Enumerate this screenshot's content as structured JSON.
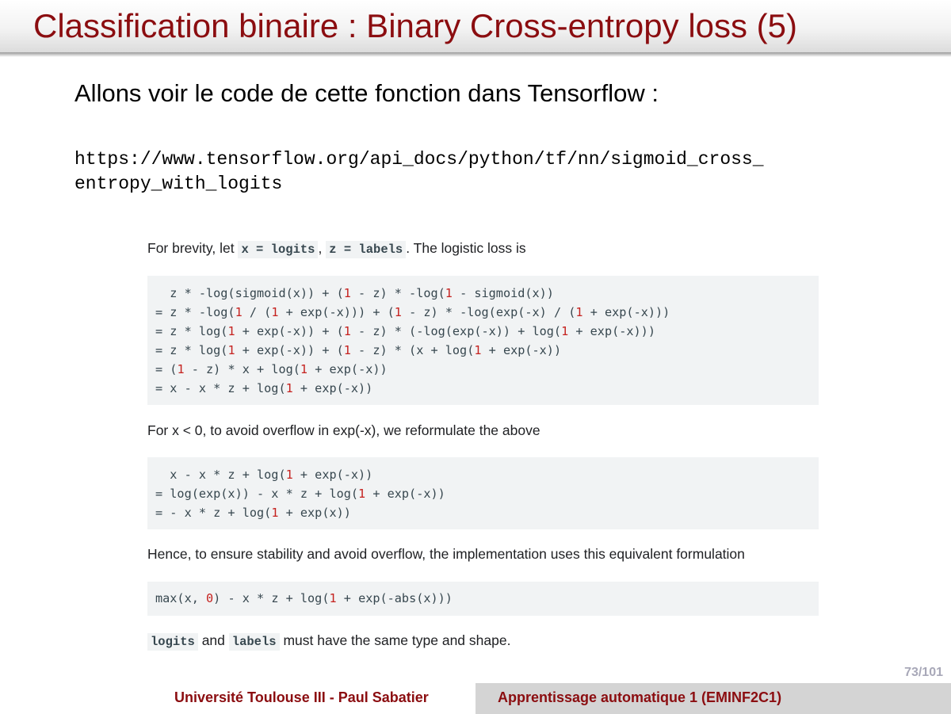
{
  "slide": {
    "title": "Classification binaire : Binary Cross-entropy loss (5)",
    "intro": "Allons voir le code de cette fonction dans Tensorflow :",
    "url_line1": "https://www.tensorflow.org/api_docs/python/tf/nn/sigmoid_cross_",
    "url_line2": "entropy_with_logits",
    "page_number": "73/101"
  },
  "doc": {
    "p1_prefix": "For brevity, let",
    "p1_code1": "x = logits",
    "p1_sep": ",",
    "p1_code2": "z = labels",
    "p1_suffix": ". The logistic loss is",
    "code1": [
      [
        {
          "t": "  z * -log(sigmoid(x)) + ("
        },
        {
          "t": "1",
          "n": true
        },
        {
          "t": " - z) * -log("
        },
        {
          "t": "1",
          "n": true
        },
        {
          "t": " - sigmoid(x))"
        }
      ],
      [
        {
          "t": "= z * -log("
        },
        {
          "t": "1",
          "n": true
        },
        {
          "t": " / ("
        },
        {
          "t": "1",
          "n": true
        },
        {
          "t": " + exp(-x))) + ("
        },
        {
          "t": "1",
          "n": true
        },
        {
          "t": " - z) * -log(exp(-x) / ("
        },
        {
          "t": "1",
          "n": true
        },
        {
          "t": " + exp(-x)))"
        }
      ],
      [
        {
          "t": "= z * log("
        },
        {
          "t": "1",
          "n": true
        },
        {
          "t": " + exp(-x)) + ("
        },
        {
          "t": "1",
          "n": true
        },
        {
          "t": " - z) * (-log(exp(-x)) + log("
        },
        {
          "t": "1",
          "n": true
        },
        {
          "t": " + exp(-x)))"
        }
      ],
      [
        {
          "t": "= z * log("
        },
        {
          "t": "1",
          "n": true
        },
        {
          "t": " + exp(-x)) + ("
        },
        {
          "t": "1",
          "n": true
        },
        {
          "t": " - z) * (x + log("
        },
        {
          "t": "1",
          "n": true
        },
        {
          "t": " + exp(-x))"
        }
      ],
      [
        {
          "t": "= ("
        },
        {
          "t": "1",
          "n": true
        },
        {
          "t": " - z) * x + log("
        },
        {
          "t": "1",
          "n": true
        },
        {
          "t": " + exp(-x))"
        }
      ],
      [
        {
          "t": "= x - x * z + log("
        },
        {
          "t": "1",
          "n": true
        },
        {
          "t": " + exp(-x))"
        }
      ]
    ],
    "p2": "For x < 0, to avoid overflow in exp(-x), we reformulate the above",
    "code2": [
      [
        {
          "t": "  x - x * z + log("
        },
        {
          "t": "1",
          "n": true
        },
        {
          "t": " + exp(-x))"
        }
      ],
      [
        {
          "t": "= log(exp(x)) - x * z + log("
        },
        {
          "t": "1",
          "n": true
        },
        {
          "t": " + exp(-x))"
        }
      ],
      [
        {
          "t": "= - x * z + log("
        },
        {
          "t": "1",
          "n": true
        },
        {
          "t": " + exp(x))"
        }
      ]
    ],
    "p3": "Hence, to ensure stability and avoid overflow, the implementation uses this equivalent formulation",
    "code3": [
      [
        {
          "t": "max(x, "
        },
        {
          "t": "0",
          "n": true
        },
        {
          "t": ") - x * z + log("
        },
        {
          "t": "1",
          "n": true
        },
        {
          "t": " + exp(-abs(x)))"
        }
      ]
    ],
    "p4_code1": "logits",
    "p4_mid": "and",
    "p4_code2": "labels",
    "p4_suffix": "must have the same type and shape."
  },
  "footer": {
    "left": "Université Toulouse III - Paul Sabatier",
    "right": "Apprentissage automatique 1 (EMINF2C1)"
  },
  "colors": {
    "title": "#8b0d10",
    "footer_text": "#8b0d10",
    "code_number": "#c5221f",
    "code_bg": "#f1f3f4",
    "page_number": "#a8a8b8"
  }
}
